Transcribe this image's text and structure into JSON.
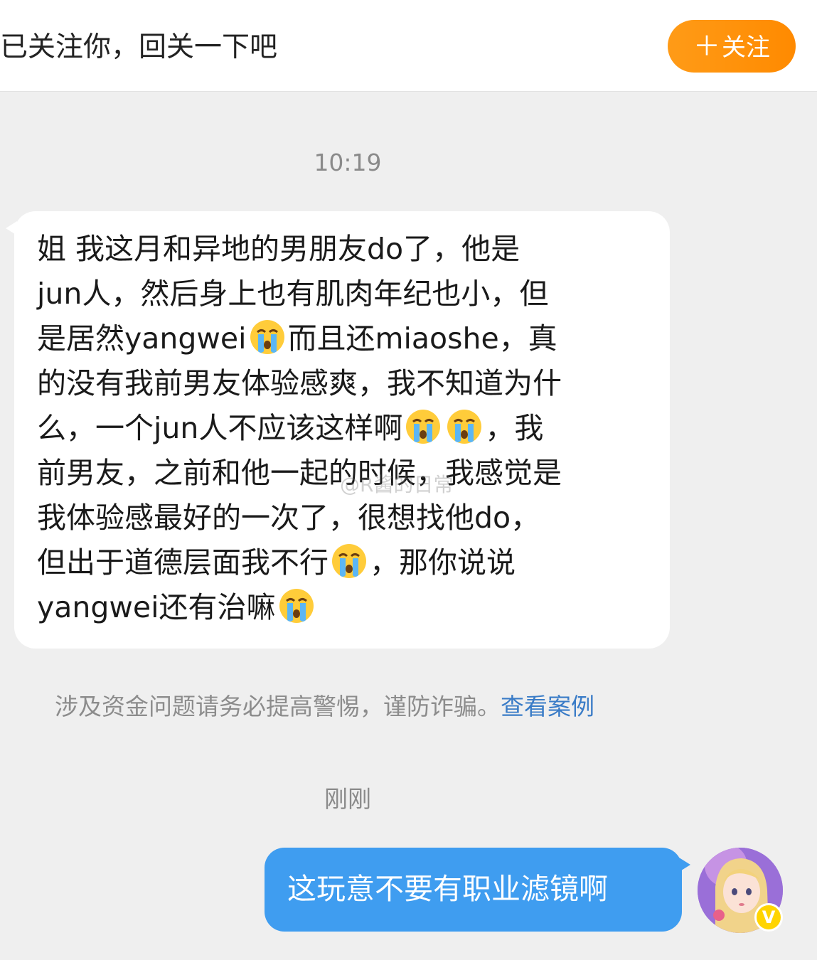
{
  "header": {
    "notice_text": "已关注你，回关一下吧",
    "follow_button_label": "关注",
    "follow_button_icon": "plus-icon",
    "accent_color": "#ff8a00"
  },
  "messages": {
    "time_1": "10:19",
    "received": {
      "lines": [
        "姐 我这月和异地的男朋友do了，他是",
        "jun人，然后身上也有肌肉年纪也小，但",
        "是居然yangwei",
        "而且还miaoshe，真",
        "的没有我前男友体验感爽，我不知道为什",
        "么，一个jun人不应该这样啊",
        "，我",
        "前男友，之前和他一起的时候，我感觉是",
        "我体验感最好的一次了，很想找他do，",
        "但出于道德层面我不行",
        "，那你说说",
        "yangwei还有治嘛"
      ],
      "emoji_name": "loudly-crying-face"
    },
    "warning_text": "涉及资金问题请务必提高警惕，谨防诈骗。",
    "warning_link": "查看案例",
    "time_2": "刚刚",
    "sent": {
      "text": "这玩意不要有职业滤镜啊",
      "bubble_color": "#3f9df0"
    }
  },
  "watermark": "@R酱的日常",
  "avatar": {
    "icon": "avatar",
    "badge_text": "V",
    "badge_color": "#ffd400"
  }
}
